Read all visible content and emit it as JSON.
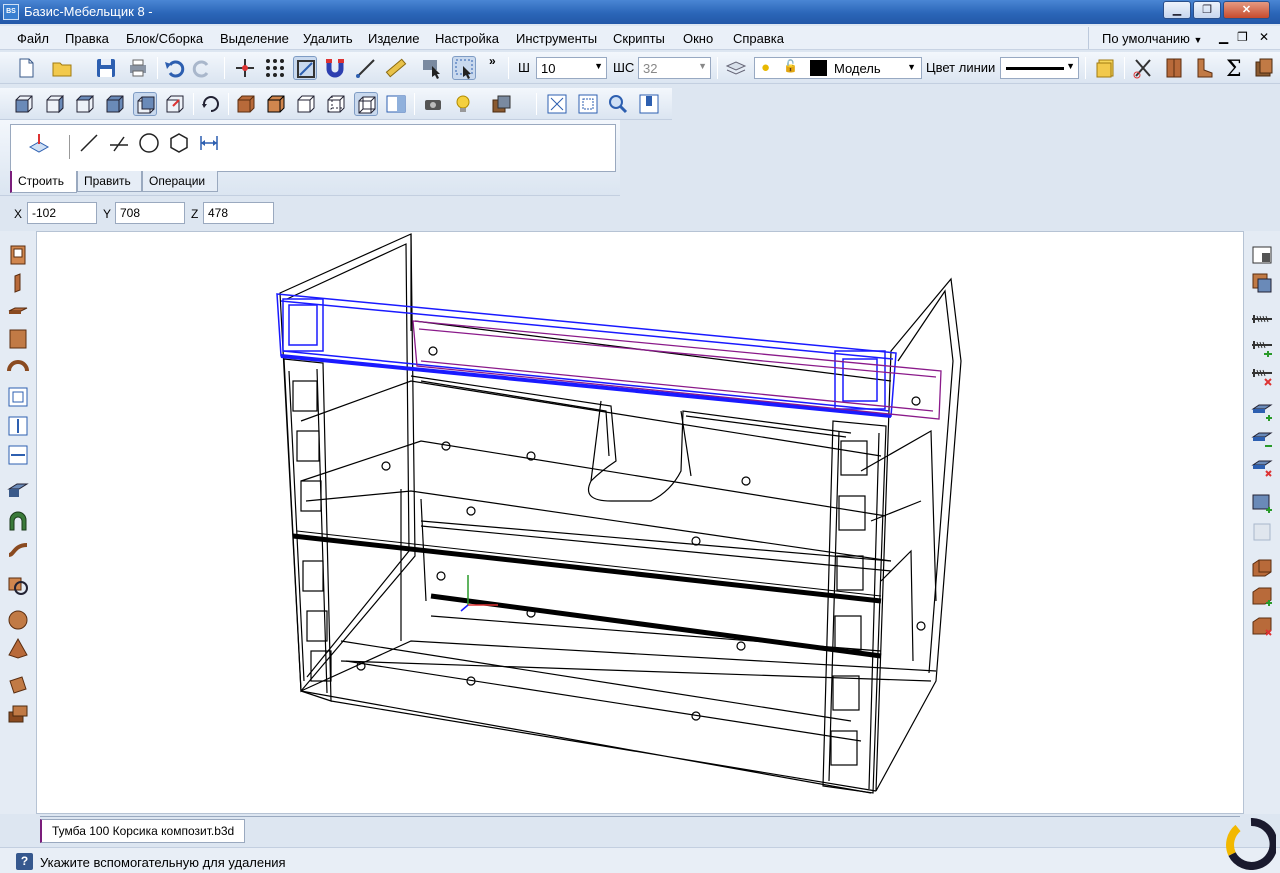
{
  "window": {
    "title": "Базис-Мебельщик 8 -",
    "app_icon_text": "BS",
    "buttons": [
      "▁",
      "❐",
      "✕"
    ]
  },
  "menu": {
    "items": [
      "Файл",
      "Правка",
      "Блок/Сборка",
      "Выделение",
      "Удалить",
      "Изделие",
      "Настройка",
      "Инструменты",
      "Скрипты",
      "Окно",
      "Справка"
    ],
    "preset": "По умолчанию",
    "mdi_buttons": [
      "▁",
      "❐",
      "✕"
    ]
  },
  "toolbar": {
    "width_label": "Ш",
    "width_value": "10",
    "shc_label": "ШС",
    "shc_value": "32",
    "layer_value": "Модель",
    "line_color_label": "Цвет линии",
    "overflow": "»",
    "layer_color": "#000000"
  },
  "panel": {
    "tabs": [
      "Строить",
      "Править",
      "Операции"
    ],
    "active_tab": "Строить"
  },
  "coords": {
    "x_label": "X",
    "x_value": "-102",
    "y_label": "Y",
    "y_value": "708",
    "z_label": "Z",
    "z_value": "478"
  },
  "document": {
    "tab": "Тумба 100 Корсика композит.b3d"
  },
  "status": {
    "icon": "?",
    "text": "Укажите вспомогательную для удаления"
  },
  "colors": {
    "selection": "#1a1aff",
    "highlight": "#8a1a8a",
    "accent_tab": "#7b1d7b"
  },
  "icons": {
    "file_toolbar": [
      "new-file-icon",
      "open-folder-icon",
      "save-icon",
      "print-icon",
      "undo-icon",
      "redo-icon"
    ],
    "snap_toolbar": [
      "axis-snap-icon",
      "grid-snap-icon",
      "frame-snap-icon",
      "magnet-icon",
      "line-measure-icon",
      "ruler-icon",
      "select-pointer-icon",
      "select-window-icon"
    ],
    "view_toolbar": [
      "view-front-icon",
      "view-left-icon",
      "view-top-icon",
      "view-iso-icon",
      "view-back-icon",
      "view-axes-icon",
      "rotate-view-icon",
      "shaded-icon",
      "shaded-edges-icon",
      "wireframe-icon",
      "hidden-lines-icon",
      "selected-wire-icon",
      "panel-view-icon",
      "camera-icon",
      "light-bulb-icon",
      "material-icon",
      "zoom-all-icon",
      "zoom-window-icon",
      "zoom-icon",
      "zoom-pan-icon"
    ],
    "draw_tools": [
      "construct-icon",
      "line-icon",
      "parallel-line-icon",
      "circle-icon",
      "hexagon-icon",
      "dimension-icon"
    ],
    "left_tools": [
      "panel-front-icon",
      "panel-vertical-icon",
      "panel-horizontal-icon",
      "panel-back-icon",
      "bent-panel-icon",
      "frame-panel-icon",
      "vertical-size-icon",
      "horizontal-size-icon",
      "profile-extrude-icon",
      "arch-icon",
      "curved-panel-icon",
      "body-rotation-icon",
      "sphere-icon",
      "cone-icon",
      "pipe-icon",
      "block-icon"
    ],
    "right_tools": [
      "fastener-list-icon",
      "fastener-add-icon",
      "screw-icon",
      "screw-add-icon",
      "screw-delete-icon",
      "edge-add-icon",
      "edge-move-icon",
      "edge-delete-icon",
      "hole-add-icon",
      "hole-icon",
      "drawer-icon",
      "drawer-add-icon",
      "drawer-delete-icon"
    ],
    "logo": "ring-logo-icon"
  }
}
